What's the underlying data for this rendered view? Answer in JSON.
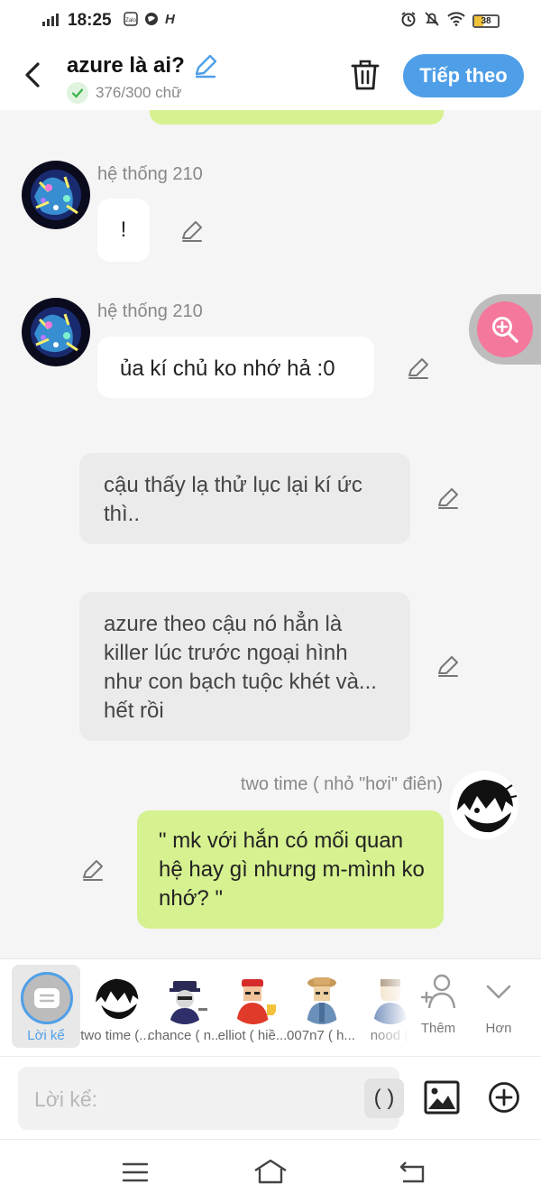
{
  "status_bar": {
    "time": "18:25",
    "battery": "38"
  },
  "header": {
    "title": "azure là ai?",
    "word_count": "376/300 chữ",
    "next_label": "Tiếp theo"
  },
  "messages": [
    {
      "sender": "hệ thống 210",
      "text": "!"
    },
    {
      "sender": "hệ thống 210",
      "text": "ủa kí chủ ko nhớ hả :0"
    },
    {
      "sender": "",
      "text": "cậu thấy lạ thử lục lại kí ức thì.."
    },
    {
      "sender": "",
      "text": "azure theo cậu nó hẳn là killer lúc trước ngoại hình như con bạch tuộc khét và... hết rồi"
    },
    {
      "sender": "two time ( nhỏ \"hơi\" điên)",
      "text": "\" mk với hắn có mối quan hệ hay gì nhưng m-mình ko nhớ? \""
    }
  ],
  "characters": [
    {
      "label": "Lời kể",
      "selected": true
    },
    {
      "label": "two time (..."
    },
    {
      "label": "chance ( n..."
    },
    {
      "label": "elliot ( hiề..."
    },
    {
      "label": "007n7 ( h..."
    },
    {
      "label": "nood ("
    }
  ],
  "char_actions": {
    "add_label": "Thêm",
    "more_label": "Hơn"
  },
  "input": {
    "placeholder": "Lời kể:",
    "paren_label": "( )"
  },
  "colors": {
    "accent": "#4f9fe8",
    "bubble_green": "#d6f18f",
    "zoom_pink": "#f4789c"
  }
}
